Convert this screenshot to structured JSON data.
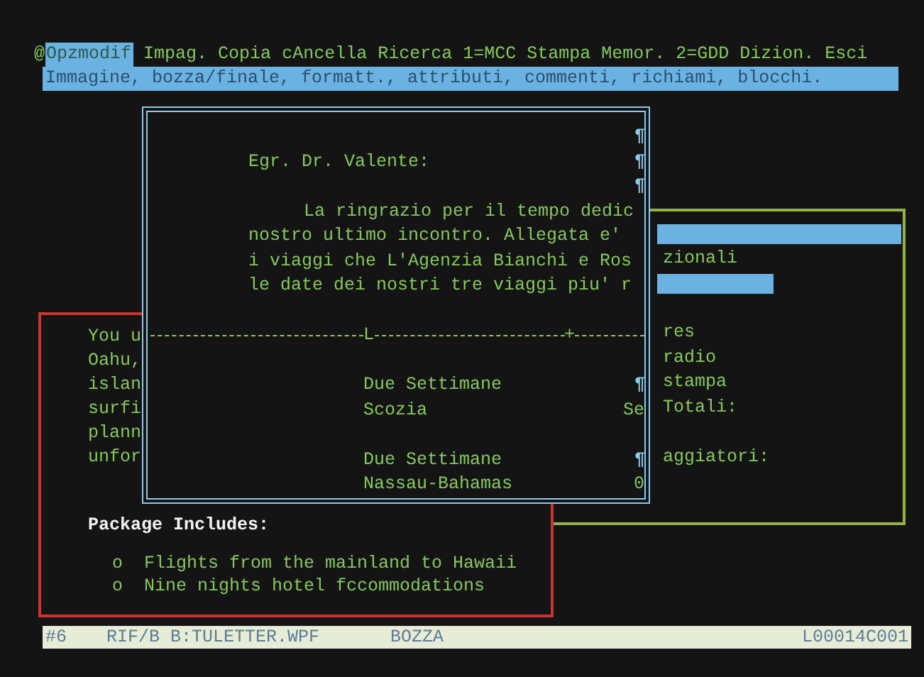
{
  "menu_bar": {
    "marker": "@",
    "items": [
      {
        "label": "Opzmodif",
        "selected": true
      },
      {
        "label": "Impag.",
        "selected": false
      },
      {
        "label": "Copia",
        "selected": false
      },
      {
        "label": "cAncella",
        "selected": false
      },
      {
        "label": "Ricerca",
        "selected": false
      },
      {
        "label": "1=MCC",
        "selected": false
      },
      {
        "label": "Stampa",
        "selected": false
      },
      {
        "label": "Memor.",
        "selected": false
      },
      {
        "label": "2=GDD",
        "selected": false
      },
      {
        "label": "Dizion.",
        "selected": false
      },
      {
        "label": "Esci",
        "selected": false
      }
    ]
  },
  "menu_hint": "Immagine, bozza/finale, formatt., attributi, commenti, richiami, blocchi.",
  "background_window": {
    "rows": [
      {
        "kind": "bar"
      },
      {
        "kind": "text",
        "text": "zionali"
      },
      {
        "kind": "bar"
      },
      {
        "kind": "blank"
      },
      {
        "kind": "text",
        "text": "res"
      },
      {
        "kind": "text",
        "text": "radio"
      },
      {
        "kind": "text",
        "text": "stampa"
      },
      {
        "kind": "text",
        "text": "Totali:"
      },
      {
        "kind": "blank"
      },
      {
        "kind": "text",
        "text": "aggiatori:"
      }
    ]
  },
  "flyer_window": {
    "lines": [
      "You u",
      "Oahu,",
      "islan",
      "surfi",
      "plann",
      "unfor"
    ],
    "heading": "Package Includes:",
    "bullets": [
      {
        "marker": "o",
        "text": "Flights from the mainland to Hawaii"
      },
      {
        "marker": "o",
        "text": "Nine nights hotel fccommodations"
      }
    ]
  },
  "letter_window": {
    "rows": [
      {
        "kind": "blank",
        "mark": "¶"
      },
      {
        "kind": "text",
        "text": "Egr. Dr. Valente:",
        "mark": "¶"
      },
      {
        "kind": "blank",
        "mark": "¶"
      },
      {
        "kind": "paragraph_start",
        "text": "La ringrazio per il tempo dedic"
      },
      {
        "kind": "text",
        "text": "nostro ultimo incontro. Allegata e'"
      },
      {
        "kind": "text",
        "text": "i viaggi che L'Agenzia Bianchi e Ros"
      },
      {
        "kind": "text",
        "text": "le date dei nostri tre viaggi piu' r"
      },
      {
        "kind": "blank"
      },
      {
        "kind": "ruler",
        "margin": "L",
        "tab": "+"
      },
      {
        "kind": "blank"
      },
      {
        "kind": "columns",
        "cells": [
          "Due Settimane"
        ],
        "mark": "¶"
      },
      {
        "kind": "columns",
        "cells": [
          "Scozia",
          "Se"
        ]
      },
      {
        "kind": "blank"
      },
      {
        "kind": "columns",
        "cells": [
          "Due Settimane"
        ],
        "mark": "¶"
      },
      {
        "kind": "columns",
        "cells": [
          "Nassau-Bahamas",
          "0"
        ]
      }
    ]
  },
  "status_bar": {
    "page": "#6",
    "file": "RIF/B B:TULETTER.WPF",
    "mode": "BOZZA",
    "position": "L00014C001"
  }
}
